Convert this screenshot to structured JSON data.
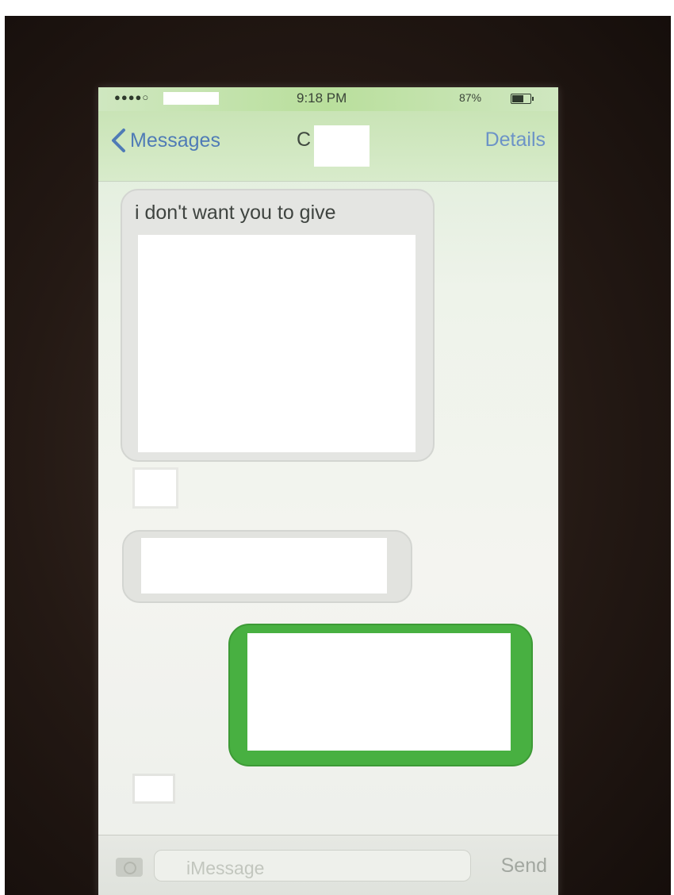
{
  "status_bar": {
    "signal": "●●●●○",
    "time": "9:18 PM",
    "battery_pct": "87%"
  },
  "nav": {
    "back_label": "Messages",
    "contact_initial": "C",
    "details_label": "Details"
  },
  "messages": [
    {
      "direction": "incoming",
      "text": "i don't want you to give"
    }
  ],
  "input": {
    "placeholder": "iMessage",
    "send_label": "Send"
  },
  "colors": {
    "outgoing_bubble": "#48b041",
    "link_blue": "#4f7bb6",
    "nav_green_tint": "#c9e4b6"
  }
}
